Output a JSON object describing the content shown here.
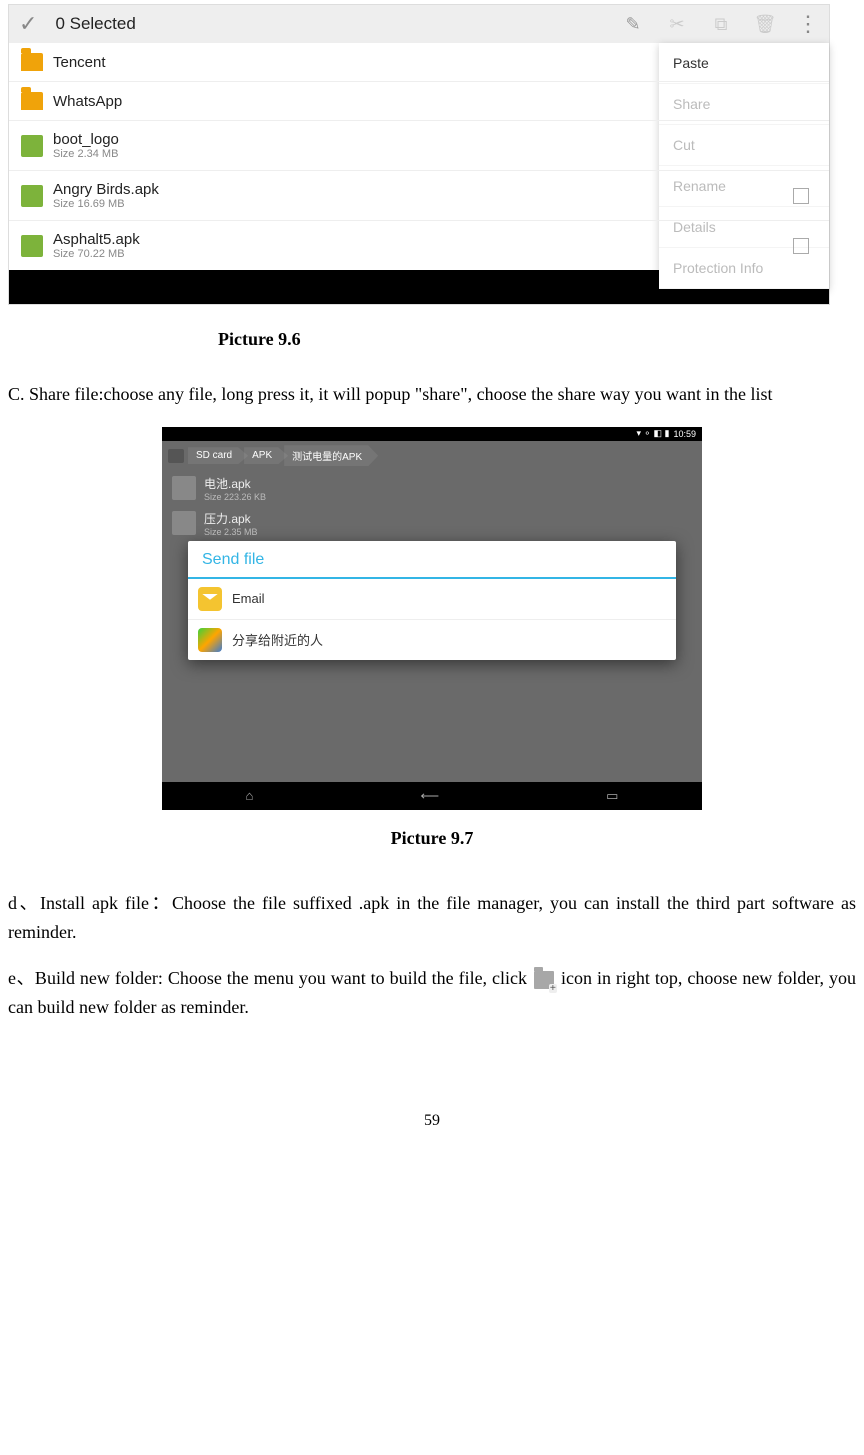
{
  "shot96": {
    "selected_text": "0 Selected",
    "popup": {
      "paste": "Paste",
      "share": "Share",
      "cut": "Cut",
      "rename": "Rename",
      "details": "Details",
      "protection": "Protection Info"
    },
    "items": [
      {
        "name": "Tencent",
        "type": "folder"
      },
      {
        "name": "WhatsApp",
        "type": "folder"
      },
      {
        "name": "boot_logo",
        "type": "file",
        "size": "Size 2.34 MB"
      },
      {
        "name": "Angry Birds.apk",
        "type": "file",
        "size": "Size 16.69 MB",
        "checkbox": true
      },
      {
        "name": "Asphalt5.apk",
        "type": "file",
        "size": "Size 70.22 MB",
        "checkbox": true
      }
    ]
  },
  "caption96": "Picture 9.6",
  "paraC": "C. Share file:choose any file, long press it, it will popup \"share\", choose the share way you want in the list",
  "shot97": {
    "time": "10:59",
    "crumb1": "SD card",
    "crumb2": "APK",
    "crumb3": "测试电量的APK",
    "file1_name": "电池.apk",
    "file1_size": "Size 223.26 KB",
    "file2_name": "压力.apk",
    "file2_size": "Size 2.35 MB",
    "dialog_title": "Send file",
    "opt_email": "Email",
    "opt_nearby": "分享给附近的人"
  },
  "caption97": "Picture 9.7",
  "paraD": "d、Install apk file：Choose the file suffixed .apk in the file manager, you can install the third part software as reminder.",
  "paraE_pre": "e、Build new folder: Choose the menu you want to build the file, click ",
  "paraE_post": " icon in right top, choose new folder, you can build new folder as reminder.",
  "page_number": "59"
}
